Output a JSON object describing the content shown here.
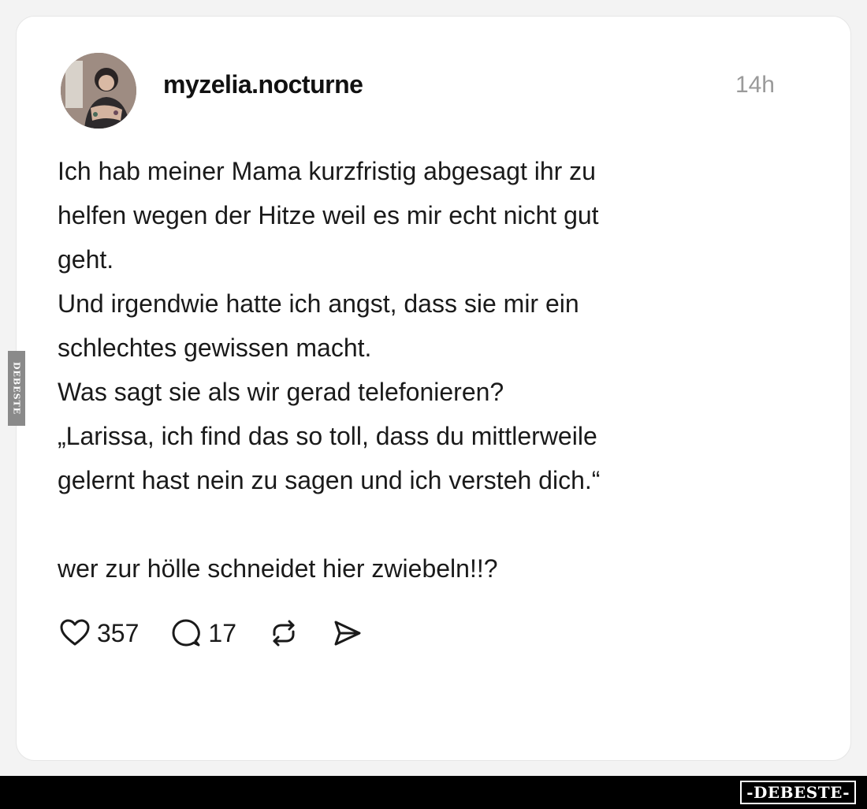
{
  "post": {
    "username": "myzelia.nocturne",
    "time": "14h",
    "lines": [
      "Ich hab meiner Mama kurzfristig abgesagt ihr zu",
      "helfen wegen der Hitze weil es mir echt nicht gut",
      "geht.",
      "Und irgendwie hatte ich angst, dass sie mir ein",
      "schlechtes gewissen macht.",
      "Was sagt sie als wir gerad telefonieren?",
      "„Larissa, ich find das so toll, dass du mittlerweile",
      "gelernt hast nein zu sagen und ich versteh dich.“",
      "",
      "wer zur hölle schneidet hier zwiebeln!!?"
    ],
    "likes": "357",
    "comments": "17"
  },
  "icons": {
    "like": "heart-icon",
    "comment": "comment-bubble-icon",
    "repost": "repost-icon",
    "share": "send-icon"
  },
  "watermark": {
    "side": "DEBESTE",
    "bottom": "-DEBESTE-"
  }
}
